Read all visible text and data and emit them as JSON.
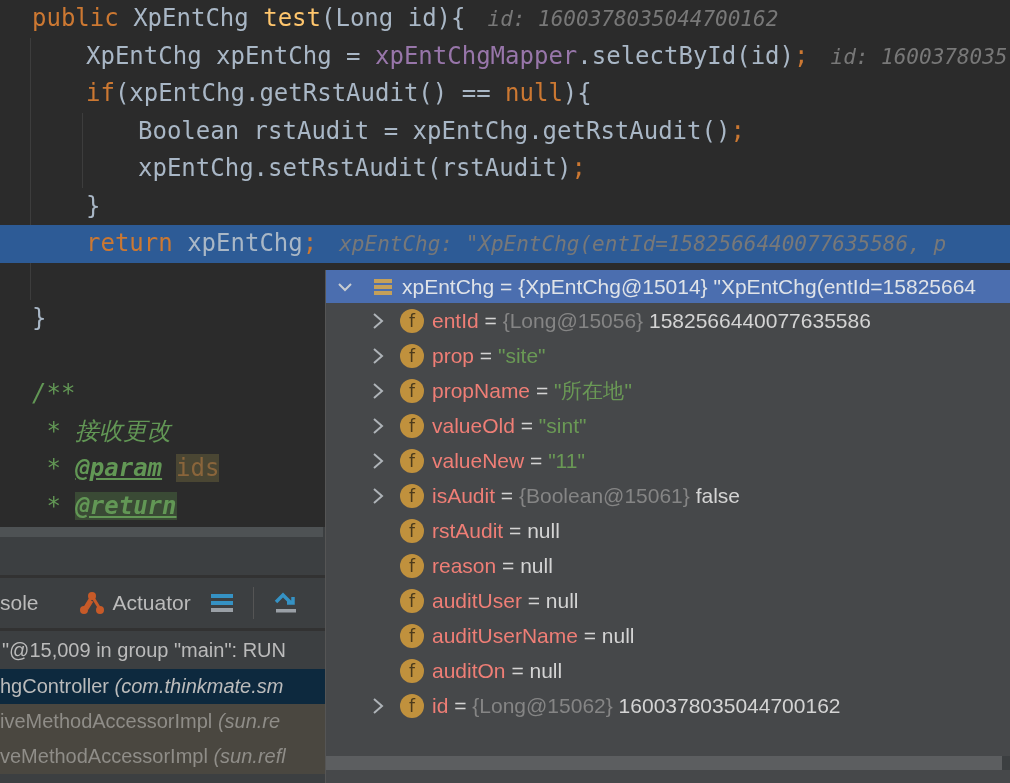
{
  "editor": {
    "lines": [
      {
        "selected": false,
        "tokens": [
          {
            "kind": "keyword",
            "text": "public "
          },
          {
            "kind": "plain",
            "text": "XpEntChg "
          },
          {
            "kind": "method",
            "text": "test"
          },
          {
            "kind": "plain",
            "text": "(Long id){"
          }
        ],
        "hint": "id: 1600378035044700162",
        "children": [
          {
            "selected": false,
            "tokens": [
              {
                "kind": "plain",
                "text": "XpEntChg xpEntChg = "
              },
              {
                "kind": "field",
                "text": "xpEntChgMapper"
              },
              {
                "kind": "plain",
                "text": ".selectById(id)"
              },
              {
                "kind": "keyword",
                "text": ";"
              }
            ],
            "hint": "id: 1600378035"
          },
          {
            "selected": false,
            "tokens": [
              {
                "kind": "keyword",
                "text": "if"
              },
              {
                "kind": "plain",
                "text": "(xpEntChg.getRstAudit() == "
              },
              {
                "kind": "keyword",
                "text": "null"
              },
              {
                "kind": "plain",
                "text": "){"
              }
            ],
            "children": [
              {
                "selected": false,
                "tokens": [
                  {
                    "kind": "plain",
                    "text": "Boolean rstAudit = xpEntChg.getRstAudit()"
                  },
                  {
                    "kind": "keyword",
                    "text": ";"
                  }
                ]
              },
              {
                "selected": false,
                "tokens": [
                  {
                    "kind": "plain",
                    "text": "xpEntChg.setRstAudit(rstAudit)"
                  },
                  {
                    "kind": "keyword",
                    "text": ";"
                  }
                ]
              }
            ]
          },
          {
            "selected": false,
            "tokens": [
              {
                "kind": "plain",
                "text": "}"
              }
            ]
          },
          {
            "selected": true,
            "tokens": [
              {
                "kind": "keyword",
                "text": "return "
              },
              {
                "kind": "plain",
                "text": "xpEntChg"
              },
              {
                "kind": "keyword",
                "text": ";"
              }
            ],
            "hint": "xpEntChg: \"XpEntChg(entId=1582566440077635586, p"
          },
          {
            "selected": false
          }
        ]
      },
      {
        "selected": false,
        "tokens": [
          {
            "kind": "plain",
            "text": "}"
          }
        ]
      },
      {
        "selected": false
      },
      {
        "selected": false,
        "tokens": [
          {
            "kind": "comment",
            "text": "/**"
          }
        ]
      },
      {
        "selected": false,
        "tokens": [
          {
            "kind": "comment",
            "text": " * 接收更改"
          }
        ]
      },
      {
        "selected": false,
        "tokens": [
          {
            "kind": "comment",
            "text": " * "
          },
          {
            "kind": "doctag",
            "text": "@param"
          },
          {
            "kind": "docparam",
            "text": "ids"
          }
        ]
      },
      {
        "selected": false,
        "tokens": [
          {
            "kind": "comment",
            "text": " * "
          },
          {
            "kind": "doctag_marked",
            "text": "@return"
          }
        ]
      }
    ]
  },
  "debug_panel": {
    "toolbar": [
      {
        "kind": "tab",
        "text": "sole"
      },
      {
        "kind": "actuator",
        "text": "Actuator"
      },
      {
        "kind": "frames_button"
      },
      {
        "kind": "step_button"
      }
    ],
    "thread": "\"@15,009 in group \"main\": RUN",
    "frames": [
      {
        "selected": true,
        "library": false,
        "method": "hgController",
        "location": "(com.thinkmate.sm"
      },
      {
        "selected": false,
        "library": true,
        "method": "iveMethodAccessorImpl",
        "location": "(sun.re"
      },
      {
        "selected": false,
        "library": true,
        "method": "veMethodAccessorImpl",
        "location": "(sun.refl"
      }
    ]
  },
  "popup": {
    "header": {
      "expanded": true,
      "text": "xpEntChg = {XpEntChg@15014} \"XpEntChg(entId=15825664"
    },
    "rows": [
      {
        "expandable": true,
        "icon": "f",
        "name": "entId",
        "parts": [
          {
            "kind": "op",
            "text": "="
          },
          {
            "kind": "type",
            "text": "{Long@15056}"
          },
          {
            "kind": "plain",
            "text": "1582566440077635586"
          }
        ]
      },
      {
        "expandable": true,
        "icon": "f",
        "name": "prop",
        "parts": [
          {
            "kind": "op",
            "text": "="
          },
          {
            "kind": "string",
            "text": "\"site\""
          }
        ]
      },
      {
        "expandable": true,
        "icon": "f",
        "name": "propName",
        "parts": [
          {
            "kind": "op",
            "text": "="
          },
          {
            "kind": "string",
            "text": "\"所在地\""
          }
        ]
      },
      {
        "expandable": true,
        "icon": "f",
        "name": "valueOld",
        "parts": [
          {
            "kind": "op",
            "text": "="
          },
          {
            "kind": "string",
            "text": "\"sint\""
          }
        ]
      },
      {
        "expandable": true,
        "icon": "f",
        "name": "valueNew",
        "parts": [
          {
            "kind": "op",
            "text": "="
          },
          {
            "kind": "string",
            "text": "\"11\""
          }
        ]
      },
      {
        "expandable": true,
        "icon": "f",
        "name": "isAudit",
        "parts": [
          {
            "kind": "op",
            "text": "="
          },
          {
            "kind": "type",
            "text": "{Boolean@15061}"
          },
          {
            "kind": "plain",
            "text": "false"
          }
        ]
      },
      {
        "expandable": false,
        "icon": "f",
        "name": "rstAudit",
        "parts": [
          {
            "kind": "op",
            "text": "="
          },
          {
            "kind": "plain",
            "text": "null"
          }
        ]
      },
      {
        "expandable": false,
        "icon": "f",
        "name": "reason",
        "parts": [
          {
            "kind": "op",
            "text": "="
          },
          {
            "kind": "plain",
            "text": "null"
          }
        ]
      },
      {
        "expandable": false,
        "icon": "f",
        "name": "auditUser",
        "parts": [
          {
            "kind": "op",
            "text": "="
          },
          {
            "kind": "plain",
            "text": "null"
          }
        ]
      },
      {
        "expandable": false,
        "icon": "f",
        "name": "auditUserName",
        "parts": [
          {
            "kind": "op",
            "text": "="
          },
          {
            "kind": "plain",
            "text": "null"
          }
        ]
      },
      {
        "expandable": false,
        "icon": "f",
        "name": "auditOn",
        "parts": [
          {
            "kind": "op",
            "text": "="
          },
          {
            "kind": "plain",
            "text": "null"
          }
        ]
      },
      {
        "expandable": true,
        "icon": "f",
        "name": "id",
        "parts": [
          {
            "kind": "op",
            "text": "="
          },
          {
            "kind": "type",
            "text": "{Long@15062}"
          },
          {
            "kind": "plain",
            "text": "1600378035044700162"
          }
        ]
      }
    ]
  }
}
